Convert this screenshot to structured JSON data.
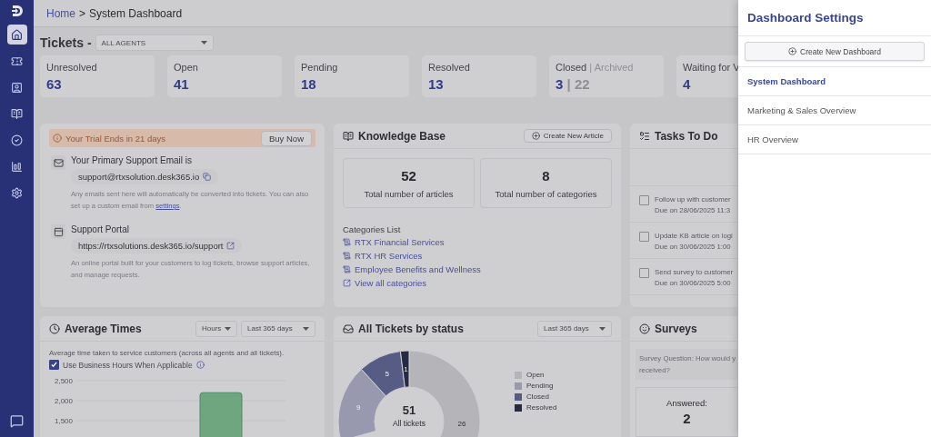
{
  "sidebar": {
    "items": [
      {
        "kind": "home",
        "selected": true
      },
      {
        "kind": "tickets",
        "selected": false
      },
      {
        "kind": "contacts",
        "selected": false
      },
      {
        "kind": "knowledge",
        "selected": false
      },
      {
        "kind": "tasks",
        "selected": false
      },
      {
        "kind": "reports",
        "selected": false
      },
      {
        "kind": "settings",
        "selected": false
      }
    ]
  },
  "breadcrumb": {
    "link": "Home",
    "separator": ">",
    "current": "System Dashboard"
  },
  "tickets": {
    "title": "Tickets -",
    "agent_filter": "ALL AGENTS",
    "stats": [
      {
        "label": "Unresolved",
        "value": "63"
      },
      {
        "label": "Open",
        "value": "41"
      },
      {
        "label": "Pending",
        "value": "18"
      },
      {
        "label": "Resolved",
        "value": "13"
      },
      {
        "label": "Closed",
        "separator": "|",
        "sublabel": "Archived",
        "value": "3",
        "value_separator": "|",
        "subvalue": "22"
      },
      {
        "label": "Waiting for V",
        "value": "4"
      }
    ]
  },
  "getting_started": {
    "trial": {
      "text": "Your Trial Ends in 21 days",
      "button": "Buy Now"
    },
    "email": {
      "title": "Your Primary Support Email is",
      "address": "support@rtxsolution.desk365.io",
      "note": "Any emails sent here will automatically be converted into tickets. You can also set up a custom email from ",
      "note_link": "settings",
      "note_end": "."
    },
    "portal": {
      "title": "Support Portal",
      "url": "https://rtxsolutions.desk365.io/support",
      "note": "An online portal built for your customers to log tickets, browse support articles, and manage requests."
    }
  },
  "knowledge_base": {
    "title": "Knowledge Base",
    "button": "Create New Article",
    "stats": [
      {
        "value": "52",
        "label": "Total number of articles"
      },
      {
        "value": "8",
        "label": "Total number of categories"
      }
    ],
    "categories_title": "Categories List",
    "categories": [
      "RTX Financial Services",
      "RTX HR Services",
      "Employee Benefits and Wellness"
    ],
    "view_all": "View all categories"
  },
  "tasks": {
    "title": "Tasks To Do",
    "items": [
      {
        "text": "Follow up with customer",
        "due": "Due on 28/06/2025 11:3",
        "checked": false
      },
      {
        "text": "Update KB article on logi",
        "due": "Due on 30/06/2025 1:00",
        "checked": false
      },
      {
        "text": "Send survey to customer",
        "due": "Due on 30/06/2025 5:00",
        "checked": false
      }
    ]
  },
  "average_times": {
    "title": "Average Times",
    "unit_filter": "Hours",
    "range_filter": "Last 365 days",
    "description": "Average time taken to service customers (across all agents and all tickets).",
    "business_hours": {
      "label": "Use Business Hours When Applicable",
      "checked": true
    },
    "chart_data": {
      "type": "bar",
      "ylim": [
        1500,
        2500
      ],
      "yticks": [
        {
          "value": 1500,
          "label": "1,500"
        },
        {
          "value": 2000,
          "label": "2,000"
        },
        {
          "value": 2500,
          "label": "2,500"
        }
      ],
      "values": [
        2200
      ],
      "color": "#6fa67f"
    }
  },
  "tickets_by_status": {
    "title": "All Tickets by status",
    "range_filter": "Last 365 days",
    "center_value": "51",
    "center_label": "All tickets",
    "chart_data": {
      "type": "donut",
      "categories": [
        "Open",
        "Pending",
        "Closed",
        "Resolved"
      ],
      "values": [
        26,
        9,
        5,
        1
      ],
      "colors": [
        "#b4b4b9",
        "#9899ae",
        "#575c84",
        "#272a44"
      ],
      "data_labels": true
    }
  },
  "surveys": {
    "title": "Surveys",
    "question": "Survey Question: How would y",
    "question_cont": "received?",
    "answered_label": "Answered:",
    "answered_value": "2"
  },
  "drawer": {
    "title": "Dashboard Settings",
    "create_button": "Create New Dashboard",
    "dashboards": [
      {
        "name": "System Dashboard",
        "selected": true
      },
      {
        "name": "Marketing & Sales Overview",
        "selected": false
      },
      {
        "name": "HR Overview",
        "selected": false
      }
    ]
  }
}
